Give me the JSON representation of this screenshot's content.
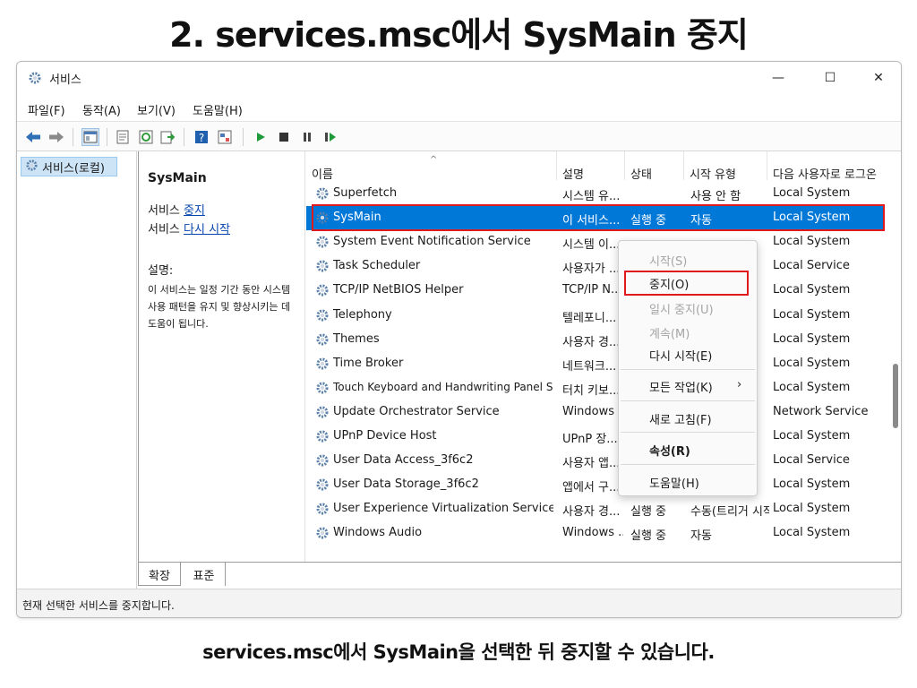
{
  "heading": "2. services.msc에서 SysMain 중지",
  "caption": "services.msc에서 SysMain을 선택한 뒤 중지할 수 있습니다.",
  "window": {
    "title": "서비스",
    "controls": {
      "minimize": "—",
      "maximize": "☐",
      "close": "✕"
    }
  },
  "menubar": [
    "파일(F)",
    "동작(A)",
    "보기(V)",
    "도움말(H)"
  ],
  "toolbar_icons": [
    "back-arrow-icon",
    "forward-arrow-icon",
    "console-tree-icon",
    "properties-icon",
    "refresh-icon",
    "export-icon",
    "help-icon",
    "view-icon",
    "start-service-icon",
    "stop-service-icon",
    "pause-service-icon",
    "restart-service-icon"
  ],
  "tree": {
    "item": "서비스(로컬)"
  },
  "detail": {
    "service_name": "SysMain",
    "action_prefix_1": "서비스 ",
    "action_link_1": "중지",
    "action_prefix_2": "서비스 ",
    "action_link_2": "다시 시작",
    "desc_label": "설명:",
    "desc_text": "이 서비스는 일정 기간 동안 시스템 사용 패턴을 유지 및 향상시키는 데 도움이 됩니다."
  },
  "columns": [
    "이름",
    "설명",
    "상태",
    "시작 유형",
    "다음 사용자로 로그온"
  ],
  "rows": [
    {
      "name": "Superfetch",
      "desc": "시스템 유...",
      "status": "",
      "startup": "사용 안 함",
      "logon": "Local System"
    },
    {
      "name": "SysMain",
      "desc": "이 서비스...",
      "status": "실행 중",
      "startup": "자동",
      "logon": "Local System"
    },
    {
      "name": "System Event Notification Service",
      "desc": "시스템 이...",
      "status": "",
      "startup": "",
      "logon": "Local System"
    },
    {
      "name": "Task Scheduler",
      "desc": "사용자가 ...",
      "status": "",
      "startup": "",
      "logon": "Local Service"
    },
    {
      "name": "TCP/IP NetBIOS Helper",
      "desc": "TCP/IP N...",
      "status": "",
      "startup": "",
      "logon": "Local System"
    },
    {
      "name": "Telephony",
      "desc": "텔레포니...",
      "status": "",
      "startup": "",
      "logon": "Local System"
    },
    {
      "name": "Themes",
      "desc": "사용자 경...",
      "status": "",
      "startup": "",
      "logon": "Local System"
    },
    {
      "name": "Time Broker",
      "desc": "네트워크...",
      "status": "",
      "startup": "",
      "logon": "Local System"
    },
    {
      "name": "Touch Keyboard and Handwriting Panel Service",
      "desc": "터치 키보...",
      "status": "",
      "startup": "",
      "logon": "Local System"
    },
    {
      "name": "Update Orchestrator Service",
      "desc": "Windows ...",
      "status": "",
      "startup": "",
      "logon": "Network Service"
    },
    {
      "name": "UPnP Device Host",
      "desc": "UPnP 장...",
      "status": "",
      "startup": "",
      "logon": "Local System"
    },
    {
      "name": "User Data Access_3f6c2",
      "desc": "사용자 앱...",
      "status": "",
      "startup": "",
      "logon": "Local Service"
    },
    {
      "name": "User Data Storage_3f6c2",
      "desc": "앱에서 구...",
      "status": "",
      "startup": "",
      "logon": "Local System"
    },
    {
      "name": "User Experience Virtualization Service",
      "desc": "사용자 경...",
      "status": "실행 중",
      "startup": "수동(트리거 시작)",
      "logon": "Local System"
    },
    {
      "name": "Windows Audio",
      "desc": "Windows ...",
      "status": "실행 중",
      "startup": "자동",
      "logon": "Local System"
    }
  ],
  "context_menu": [
    {
      "label": "시작(S)",
      "state": "disabled"
    },
    {
      "label": "중지(O)",
      "state": "enabled"
    },
    {
      "label": "일시 중지(U)",
      "state": "disabled"
    },
    {
      "label": "계속(M)",
      "state": "disabled"
    },
    {
      "label": "다시 시작(E)",
      "state": "enabled"
    },
    {
      "label": "모든 작업(K)",
      "state": "submenu",
      "arrow": "›"
    },
    {
      "label": "새로 고침(F)",
      "state": "enabled"
    },
    {
      "label": "속성(R)",
      "state": "bold"
    },
    {
      "label": "도움말(H)",
      "state": "enabled"
    }
  ],
  "tabs": [
    "확장",
    "표준"
  ],
  "status_text": "현재 선택한 서비스를 중지합니다.",
  "colors": {
    "selection": "#0078d7",
    "highlight_outline": "#e0191c",
    "link": "#0645ad"
  }
}
